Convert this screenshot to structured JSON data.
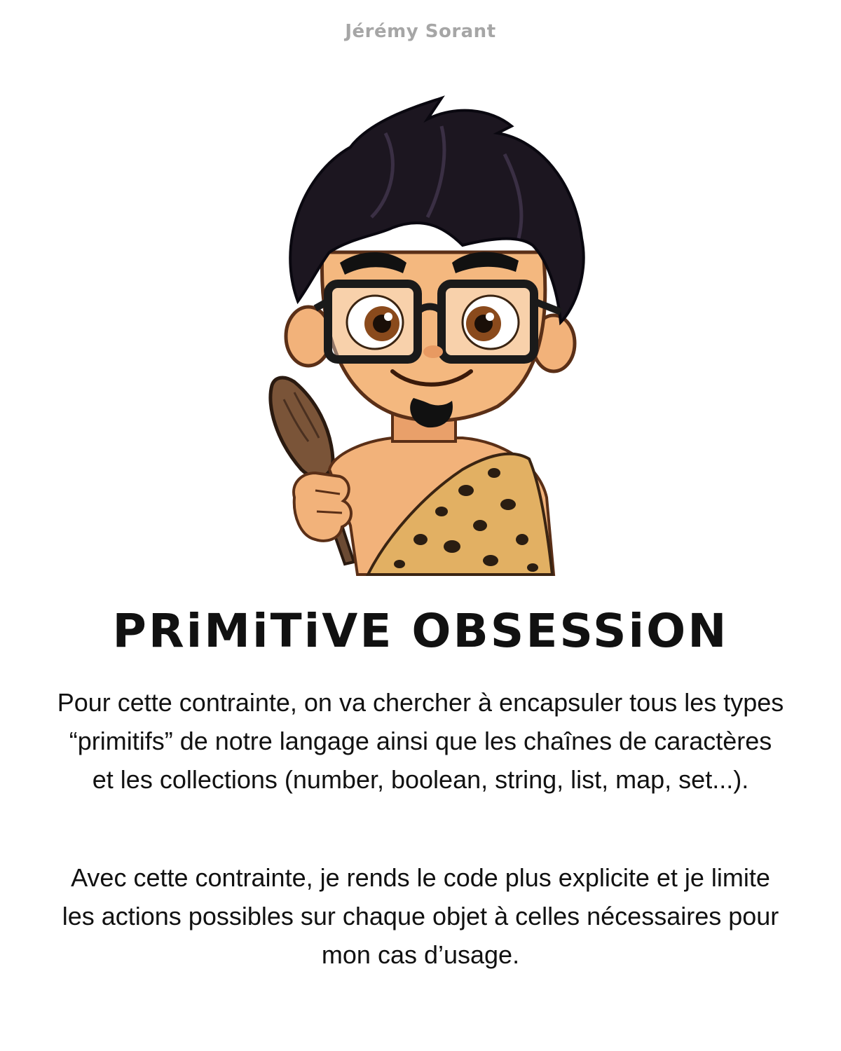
{
  "author": "Jérémy Sorant",
  "illustration": {
    "icon": "caveman-developer-illustration",
    "colors": {
      "hair": "#1c1620",
      "skin": "#f2b27a",
      "skin_shadow": "#d98a52",
      "glasses": "#1a1a1a",
      "eyes": "#8a4a1c",
      "fur": "#e2b063",
      "fur_spots": "#2a1d12",
      "club": "#6b4a33"
    }
  },
  "title": "PRiMiTiVE OBSESSiON",
  "paragraphs": [
    "Pour cette contrainte, on va chercher à encapsuler tous les types “primitifs” de notre langage ainsi que les chaînes de caractères et les collections (number, boolean, string, list, map, set...).",
    "Avec cette contrainte, je rends le code plus explicite et je limite les actions possibles sur chaque objet à celles nécessaires pour mon cas d’usage."
  ]
}
